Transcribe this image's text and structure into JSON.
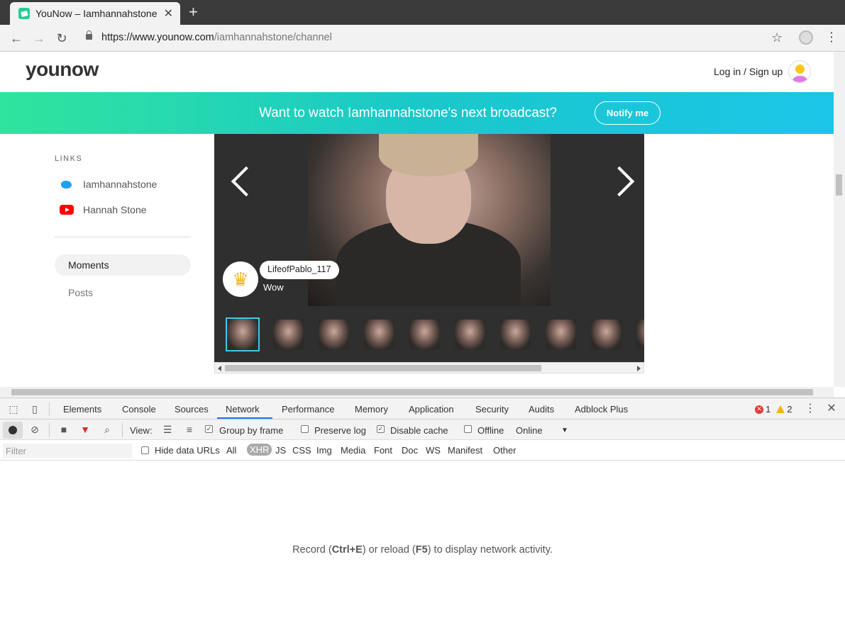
{
  "browser": {
    "tab_title": "YouNow – Iamhannahstone",
    "url_host": "https://www.younow.com",
    "url_path": "/iamhannahstone/channel"
  },
  "site": {
    "logo": "younow",
    "login": "Log in / Sign up",
    "banner_text": "Want to watch Iamhannahstone's next broadcast?",
    "notify_label": "Notify me",
    "links_heading": "LINKS",
    "links": [
      {
        "label": "Iamhannahstone",
        "icon": "twitter-icon"
      },
      {
        "label": "Hannah Stone",
        "icon": "youtube-icon"
      }
    ],
    "nav": {
      "moments": "Moments",
      "posts": "Posts"
    },
    "chat": {
      "username": "LifeofPablo_117",
      "message": "Wow"
    }
  },
  "devtools": {
    "tabs": [
      "Elements",
      "Console",
      "Sources",
      "Network",
      "Performance",
      "Memory",
      "Application",
      "Security",
      "Audits",
      "Adblock Plus"
    ],
    "active_tab": "Network",
    "errors": "1",
    "warnings": "2",
    "view_label": "View:",
    "group_by_frame": "Group by frame",
    "preserve_log": "Preserve log",
    "disable_cache": "Disable cache",
    "offline": "Offline",
    "throttle": "Online",
    "filter_placeholder": "Filter",
    "hide_data_urls": "Hide data URLs",
    "types": [
      "All",
      "XHR",
      "JS",
      "CSS",
      "Img",
      "Media",
      "Font",
      "Doc",
      "WS",
      "Manifest",
      "Other"
    ],
    "selected_type": "XHR",
    "empty": {
      "pre": "Record (",
      "k1": "Ctrl+E",
      "mid": ") or reload (",
      "k2": "F5",
      "post": ") to display network activity."
    }
  },
  "colors": {
    "accent": "#1a73e8",
    "banner_start": "#2ee59d",
    "banner_end": "#1bc5e8",
    "crown": "#f4b41a"
  }
}
